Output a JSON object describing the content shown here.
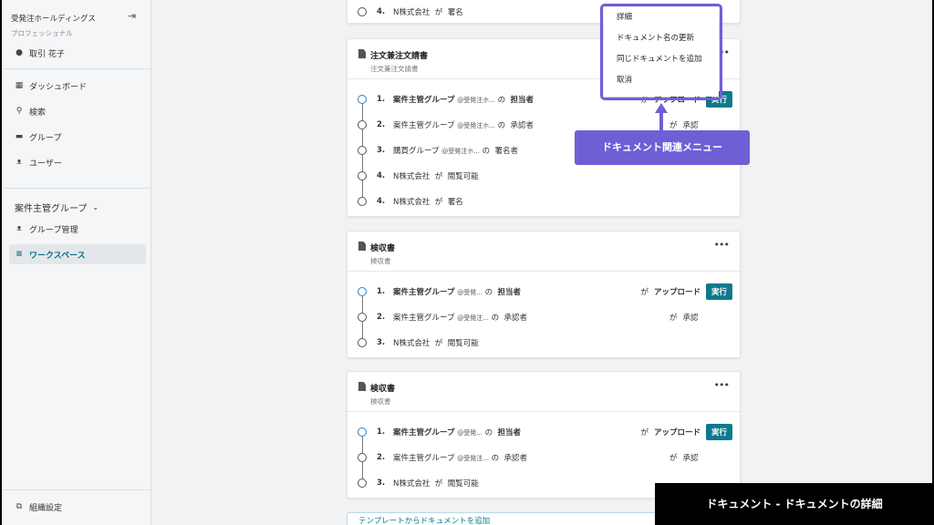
{
  "sidebar": {
    "org_name": "受発注ホールディングス",
    "plan": "プロフェッショナル",
    "user_name": "取引 花子",
    "nav": [
      {
        "label": "ダッシュボード",
        "icon": "dashboard-icon"
      },
      {
        "label": "検索",
        "icon": "search-icon"
      },
      {
        "label": "グループ",
        "icon": "folder-icon"
      },
      {
        "label": "ユーザー",
        "icon": "users-icon"
      }
    ],
    "group_name": "案件主管グループ",
    "group_items": [
      {
        "label": "グループ管理",
        "icon": "group-icon"
      },
      {
        "label": "ワークスペース",
        "icon": "list-icon",
        "active": true
      }
    ],
    "settings_label": "組織設定"
  },
  "top_partial_step": {
    "num": "4.",
    "company": "N株式会社",
    "ga": "が",
    "role": "署名"
  },
  "cards": [
    {
      "title": "注文兼注文請書",
      "subtitle": "注文兼注文請書",
      "steps": [
        {
          "num": "1.",
          "group": "案件主管グループ",
          "at": "@受発注ホ...",
          "no": "の",
          "role": "担当者",
          "ga": "が",
          "action": "アップロード",
          "button": "実行"
        },
        {
          "num": "2.",
          "group": "案件主管グループ",
          "at": "@受発注ホ...",
          "no": "の",
          "role": "承認者",
          "ga": "が",
          "action": "承認"
        },
        {
          "num": "3.",
          "group": "購買グループ",
          "at": "@受発注ホ...",
          "no": "の",
          "role": "署名者"
        },
        {
          "num": "4.",
          "company": "N株式会社",
          "ga": "が",
          "role": "閲覧可能"
        },
        {
          "num": "4.",
          "company": "N株式会社",
          "ga": "が",
          "role": "署名"
        }
      ]
    },
    {
      "title": "検収書",
      "subtitle": "検収書",
      "steps": [
        {
          "num": "1.",
          "group": "案件主管グループ",
          "at": "@受発...",
          "no": "の",
          "role": "担当者",
          "ga": "が",
          "action": "アップロード",
          "button": "実行"
        },
        {
          "num": "2.",
          "group": "案件主管グループ",
          "at": "@受発注...",
          "no": "の",
          "role": "承認者",
          "ga": "が",
          "action": "承認"
        },
        {
          "num": "3.",
          "company": "N株式会社",
          "ga": "が",
          "role": "閲覧可能"
        }
      ]
    },
    {
      "title": "検収書",
      "subtitle": "検収書",
      "steps": [
        {
          "num": "1.",
          "group": "案件主管グループ",
          "at": "@受発...",
          "no": "の",
          "role": "担当者",
          "ga": "が",
          "action": "アップロード",
          "button": "実行"
        },
        {
          "num": "2.",
          "group": "案件主管グループ",
          "at": "@受発注...",
          "no": "の",
          "role": "承認者",
          "ga": "が",
          "action": "承認"
        },
        {
          "num": "3.",
          "company": "N株式会社",
          "ga": "が",
          "role": "閲覧可能"
        }
      ]
    }
  ],
  "bottom_partial": "テンプレートからドキュメントを追加",
  "context_menu": {
    "items": [
      "詳細",
      "ドキュメント名の更新",
      "同じドキュメントを追加",
      "取消"
    ]
  },
  "callout": "ドキュメント関連メニュー",
  "caption": "ドキュメント - ドキュメントの詳細",
  "colors": {
    "accent": "#0b7a8c",
    "callout": "#6f5fd6",
    "timeline_first": "#2b7fc4"
  }
}
